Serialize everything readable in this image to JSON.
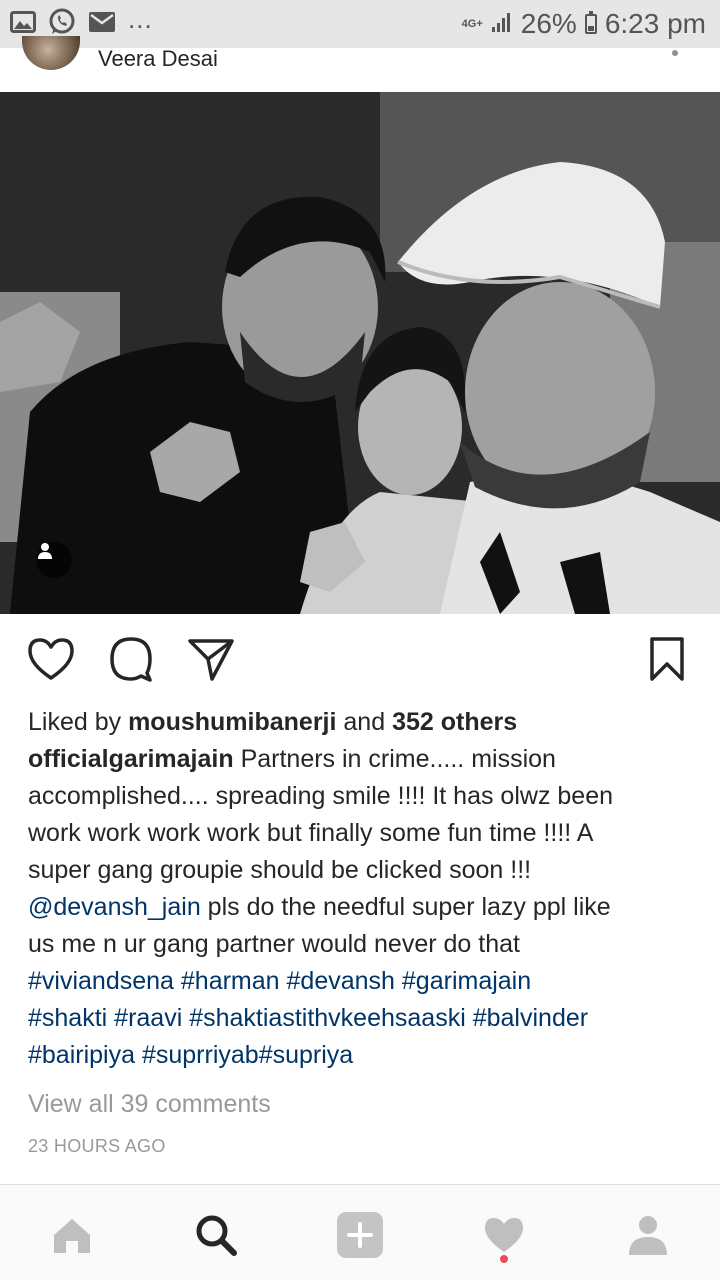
{
  "status_bar": {
    "network": "4G+",
    "battery": "26%",
    "time": "6:23 pm"
  },
  "post": {
    "author": "Veera Desai",
    "likes": {
      "prefix": "Liked by",
      "user": "moushumibanerji",
      "joiner": "and",
      "others": "352 others"
    },
    "caption": {
      "username": "officialgarimajain",
      "lines": [
        "Partners in crime..... mission",
        "accomplished.... spreading smile !!!! It has olwz been",
        "work work work work but finally some fun time !!!! A",
        "super gang groupie should be clicked soon !!!"
      ],
      "mention": "@devansh_jain",
      "after_mention": " pls do the needful super lazy ppl like",
      "line_after": "us me n ur gang partner would never do that",
      "hashtag_lines": [
        [
          "#viviandsena",
          "#harman",
          "#devansh",
          "#garimajain"
        ],
        [
          "#shakti",
          "#raavi",
          "#shaktiastithvkeehsaaski",
          "#balvinder"
        ],
        [
          "#bairipiya",
          "#suprriyab#supriya"
        ]
      ]
    },
    "view_comments": "View all 39 comments",
    "timestamp": "23 HOURS AGO"
  },
  "icons": {
    "status_left": [
      "image-icon",
      "whatsapp-icon",
      "mail-icon"
    ],
    "actions": [
      "like-icon",
      "comment-icon",
      "share-icon",
      "bookmark-icon"
    ],
    "nav": [
      "home-icon",
      "search-icon",
      "add-post-icon",
      "activity-icon",
      "profile-icon"
    ]
  },
  "colors": {
    "link": "#003569",
    "muted": "#999999",
    "notification": "#ed4956"
  }
}
